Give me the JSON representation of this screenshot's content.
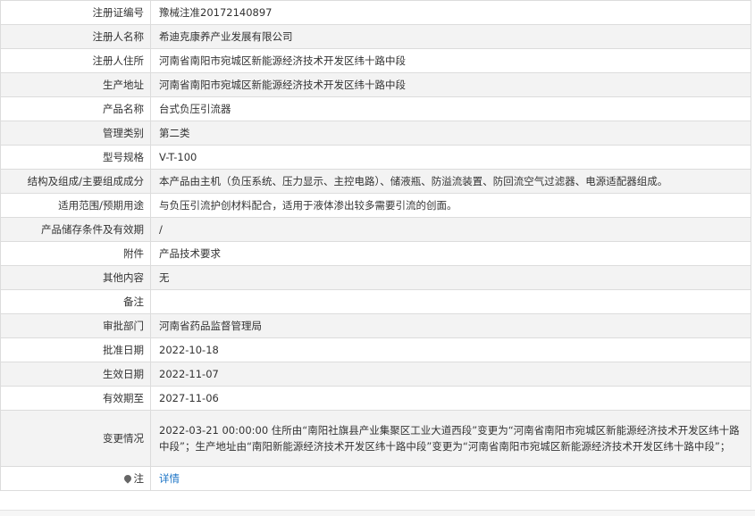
{
  "rows": [
    {
      "label": "注册证编号",
      "value": "豫械注准20172140897"
    },
    {
      "label": "注册人名称",
      "value": "希迪克康养产业发展有限公司"
    },
    {
      "label": "注册人住所",
      "value": "河南省南阳市宛城区新能源经济技术开发区纬十路中段"
    },
    {
      "label": "生产地址",
      "value": "河南省南阳市宛城区新能源经济技术开发区纬十路中段"
    },
    {
      "label": "产品名称",
      "value": "台式负压引流器"
    },
    {
      "label": "管理类别",
      "value": "第二类"
    },
    {
      "label": "型号规格",
      "value": "V-T-100"
    },
    {
      "label": "结构及组成/主要组成成分",
      "value": "本产品由主机（负压系统、压力显示、主控电路）、储液瓶、防溢流装置、防回流空气过滤器、电源适配器组成。"
    },
    {
      "label": "适用范围/预期用途",
      "value": "与负压引流护创材料配合，适用于液体渗出较多需要引流的创面。"
    },
    {
      "label": "产品储存条件及有效期",
      "value": "/"
    },
    {
      "label": "附件",
      "value": "产品技术要求"
    },
    {
      "label": "其他内容",
      "value": "无"
    },
    {
      "label": "备注",
      "value": ""
    },
    {
      "label": "审批部门",
      "value": "河南省药品监督管理局"
    },
    {
      "label": "批准日期",
      "value": "2022-10-18"
    },
    {
      "label": "生效日期",
      "value": "2022-11-07"
    },
    {
      "label": "有效期至",
      "value": "2027-11-06"
    }
  ],
  "change": {
    "label": "变更情况",
    "value": "2022-03-21 00:00:00 住所由“南阳社旗县产业集聚区工业大道西段”变更为“河南省南阳市宛城区新能源经济技术开发区纬十路中段”；生产地址由“南阳新能源经济技术开发区纬十路中段”变更为“河南省南阳市宛城区新能源经济技术开发区纬十路中段”；"
  },
  "note": {
    "label": "注",
    "icon": "location-pin-icon",
    "link_text": "详情",
    "link_color": "#1a73c6"
  }
}
